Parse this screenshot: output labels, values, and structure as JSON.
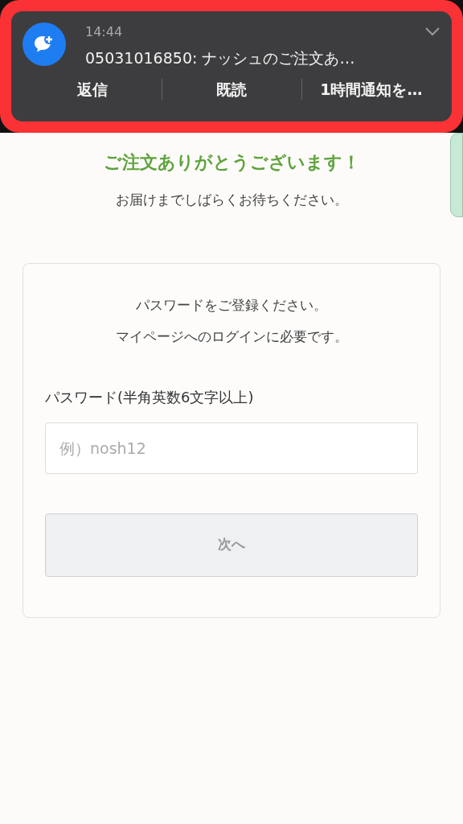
{
  "notification": {
    "time": "14:44",
    "message": "05031016850: ナッシュのご注文あ…",
    "actions": [
      "返信",
      "既読",
      "1時間通知を…"
    ],
    "highlighted": true
  },
  "heading": "ご注文ありがとうございます！",
  "subheading": "お届けまでしばらくお待ちください。",
  "card": {
    "intro_lines": [
      "パスワードをご登録ください。",
      "マイページへのログインに必要です。"
    ],
    "field": {
      "label": "パスワード(半角英数6文字以上)",
      "placeholder": "例）nosh12"
    },
    "button": {
      "label": "次へ",
      "disabled": true
    }
  }
}
